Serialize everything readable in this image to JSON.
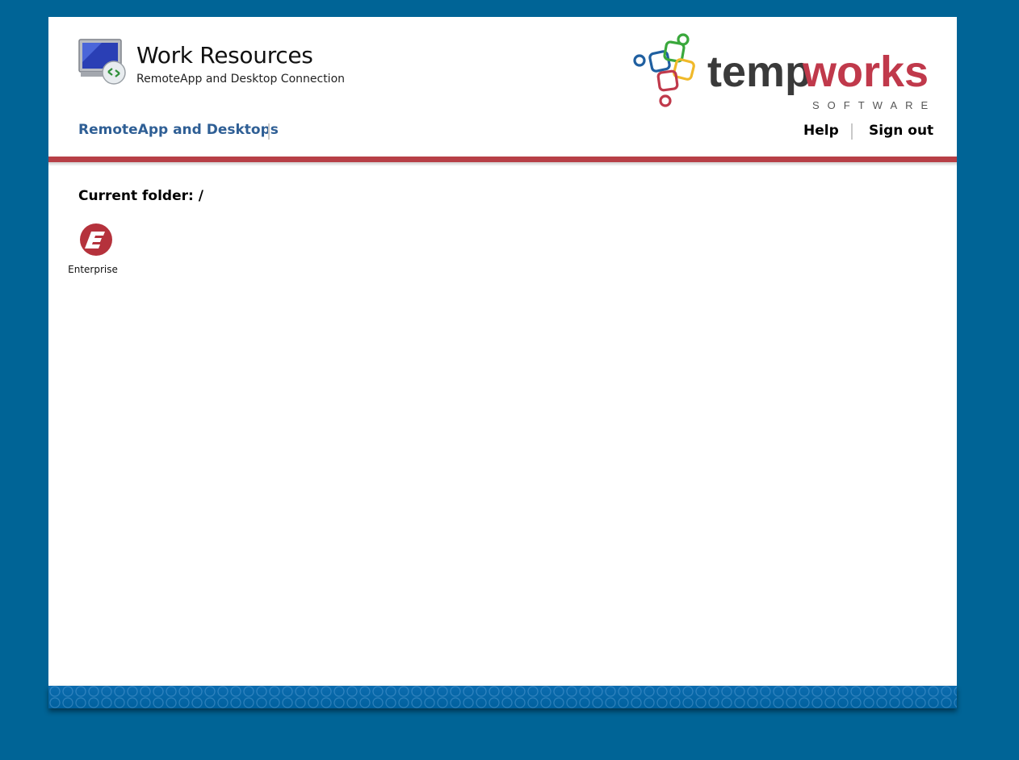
{
  "header": {
    "title": "Work Resources",
    "subtitle": "RemoteApp and Desktop Connection",
    "icon": "remote-desktop-computer-icon",
    "logo": {
      "name": "tempworks-logo",
      "word_dark": "temp",
      "word_accent": "works",
      "tagline": "SOFTWARE",
      "dark_color": "#3a3a3a",
      "accent_color": "#c0394b"
    }
  },
  "nav": {
    "remoteapp_label": "RemoteApp and Desktops",
    "help_label": "Help",
    "signout_label": "Sign out"
  },
  "main": {
    "current_folder": "Current folder: /",
    "apps": [
      {
        "label": "Enterprise",
        "icon": "enterprise-e-icon"
      }
    ]
  },
  "colors": {
    "background": "#006496",
    "accent_bar": "#b73f46",
    "nav_link": "#2f5f95"
  }
}
